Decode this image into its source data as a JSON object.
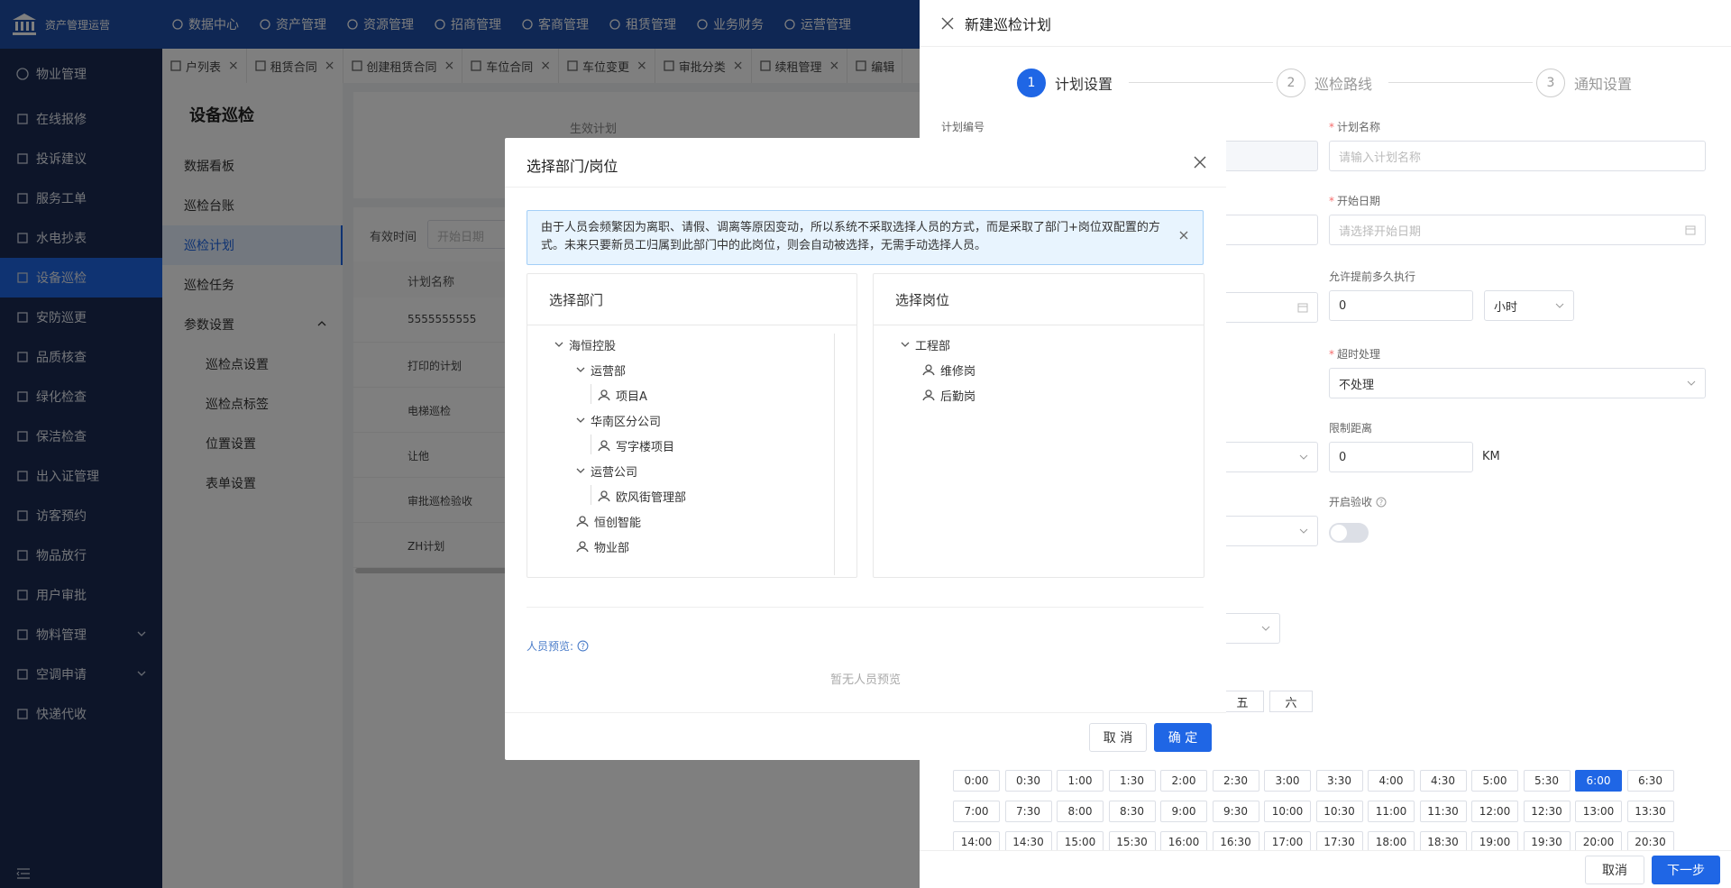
{
  "app": {
    "title": "资产管理运营"
  },
  "topnav": [
    "数据中心",
    "资产管理",
    "资源管理",
    "招商管理",
    "客商管理",
    "租赁管理",
    "业务财务",
    "运营管理"
  ],
  "sidebar": {
    "head": "物业管理",
    "items": [
      "在线报修",
      "投诉建议",
      "服务工单",
      "水电抄表",
      "设备巡检",
      "安防巡更",
      "品质核查",
      "绿化检查",
      "保洁检查",
      "出入证管理",
      "访客预约",
      "物品放行",
      "用户审批",
      "物料管理",
      "空调申请",
      "快递代收"
    ],
    "active": "设备巡检"
  },
  "tabs": [
    "户列表",
    "租赁合同",
    "创建租赁合同",
    "车位合同",
    "车位变更",
    "审批分类",
    "续租管理",
    "编辑"
  ],
  "lowleft": {
    "title": "设备巡检",
    "items": [
      "数据看板",
      "巡检台账",
      "巡检计划",
      "巡检任务",
      "参数设置"
    ],
    "subitems": [
      "巡检点设置",
      "巡检点标签",
      "位置设置",
      "表单设置"
    ]
  },
  "main": {
    "card_label": "生效计划",
    "filter_label": "有效时间",
    "filter_placeholder": "开始日期",
    "col_header": "计划名称",
    "rows": [
      "5555555555",
      "打印的计划",
      "电梯巡检",
      "让他",
      "审批巡检验收",
      "ZH计划"
    ]
  },
  "drawer": {
    "title": "新建巡检计划",
    "steps": [
      {
        "n": "1",
        "label": "计划设置"
      },
      {
        "n": "2",
        "label": "巡检路线"
      },
      {
        "n": "3",
        "label": "通知设置"
      }
    ],
    "fields": {
      "plan_no_label": "计划编号",
      "plan_name_label": "计划名称",
      "plan_name_ph": "请输入计划名称",
      "start_date_label": "开始日期",
      "start_date_ph": "请选择开始日期",
      "advance_label": "允许提前多久执行",
      "advance_value": "0",
      "advance_unit": "小时",
      "timeout_label": "超时处理",
      "timeout_value": "不处理",
      "limit_label": "限制距离",
      "limit_value": "0",
      "limit_unit": "KM",
      "verify_label": "开启验收"
    },
    "days": [
      "五",
      "六"
    ],
    "times": [
      "0:00",
      "0:30",
      "1:00",
      "1:30",
      "2:00",
      "2:30",
      "3:00",
      "3:30",
      "4:00",
      "4:30",
      "5:00",
      "5:30",
      "6:00",
      "6:30",
      "7:00",
      "7:30",
      "8:00",
      "8:30",
      "9:00",
      "9:30",
      "10:00",
      "10:30",
      "11:00",
      "11:30",
      "12:00",
      "12:30",
      "13:00",
      "13:30",
      "14:00",
      "14:30",
      "15:00",
      "15:30",
      "16:00",
      "16:30",
      "17:00",
      "17:30",
      "18:00",
      "18:30",
      "19:00",
      "19:30",
      "20:00",
      "20:30"
    ],
    "selected_time": "6:00",
    "cancel": "取消",
    "next": "下一步"
  },
  "modal": {
    "title": "选择部门/岗位",
    "alert": "由于人员会频繁因为离职、请假、调离等原因变动，所以系统不采取选择人员的方式，而是采取了部门+岗位双配置的方式。未来只要新员工归属到此部门中的此岗位，则会自动被选择，无需手动选择人员。",
    "dept_title": "选择部门",
    "post_title": "选择岗位",
    "dept_tree": [
      {
        "label": "海恒控股",
        "level": 0,
        "type": "folder"
      },
      {
        "label": "运营部",
        "level": 1,
        "type": "folder"
      },
      {
        "label": "项目A",
        "level": 2,
        "type": "leaf"
      },
      {
        "label": "华南区分公司",
        "level": 1,
        "type": "folder"
      },
      {
        "label": "写字楼项目",
        "level": 2,
        "type": "leaf"
      },
      {
        "label": "运营公司",
        "level": 1,
        "type": "folder"
      },
      {
        "label": "欧风街管理部",
        "level": 2,
        "type": "leaf"
      },
      {
        "label": "恒创智能",
        "level": 1,
        "type": "leaf"
      },
      {
        "label": "物业部",
        "level": 1,
        "type": "leaf"
      }
    ],
    "post_tree": [
      {
        "label": "工程部",
        "level": 0,
        "type": "folder"
      },
      {
        "label": "维修岗",
        "level": 1,
        "type": "leaf"
      },
      {
        "label": "后勤岗",
        "level": 1,
        "type": "leaf"
      }
    ],
    "preview_label": "人员预览:",
    "preview_empty": "暂无人员预览",
    "cancel": "取 消",
    "confirm": "确 定"
  }
}
